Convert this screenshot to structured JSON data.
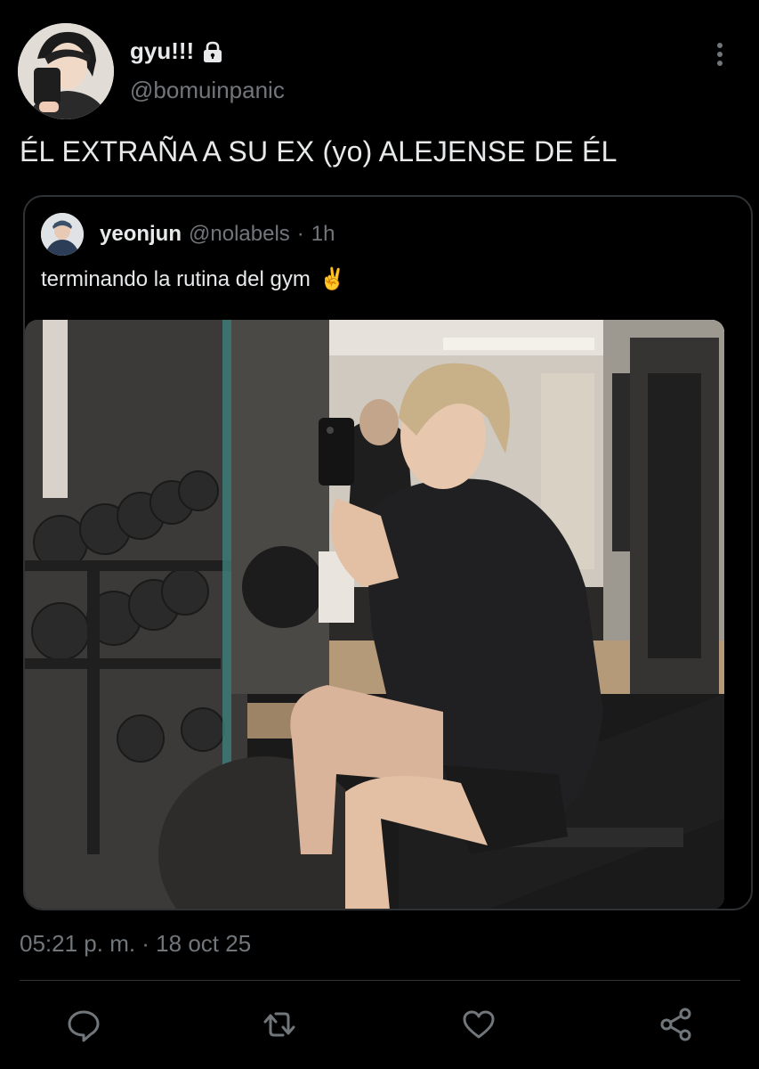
{
  "author": {
    "display_name": "gyu!!!",
    "handle": "@bomuinpanic",
    "protected_icon": "lock-icon"
  },
  "tweet": {
    "text": "ÉL EXTRAÑA A SU EX (yo) ALEJENSE DE ÉL"
  },
  "quoted_tweet": {
    "name": "yeonjun",
    "handle": "@nolabels",
    "separator": "·",
    "time": "1h",
    "text": "terminando la rutina del gym",
    "emoji": "✌️",
    "media_icon": "gym-mirror-selfie-photo"
  },
  "meta": {
    "timestamp": "05:21 p. m. · 18 oct 25"
  },
  "actions": {
    "reply_icon": "reply-icon",
    "retweet_icon": "retweet-icon",
    "like_icon": "heart-icon",
    "share_icon": "share-icon",
    "more_icon": "more-vertical-icon"
  },
  "colors": {
    "background": "#000000",
    "text_primary": "#e7e9ea",
    "text_secondary": "#71767b",
    "border": "#2f3336"
  }
}
